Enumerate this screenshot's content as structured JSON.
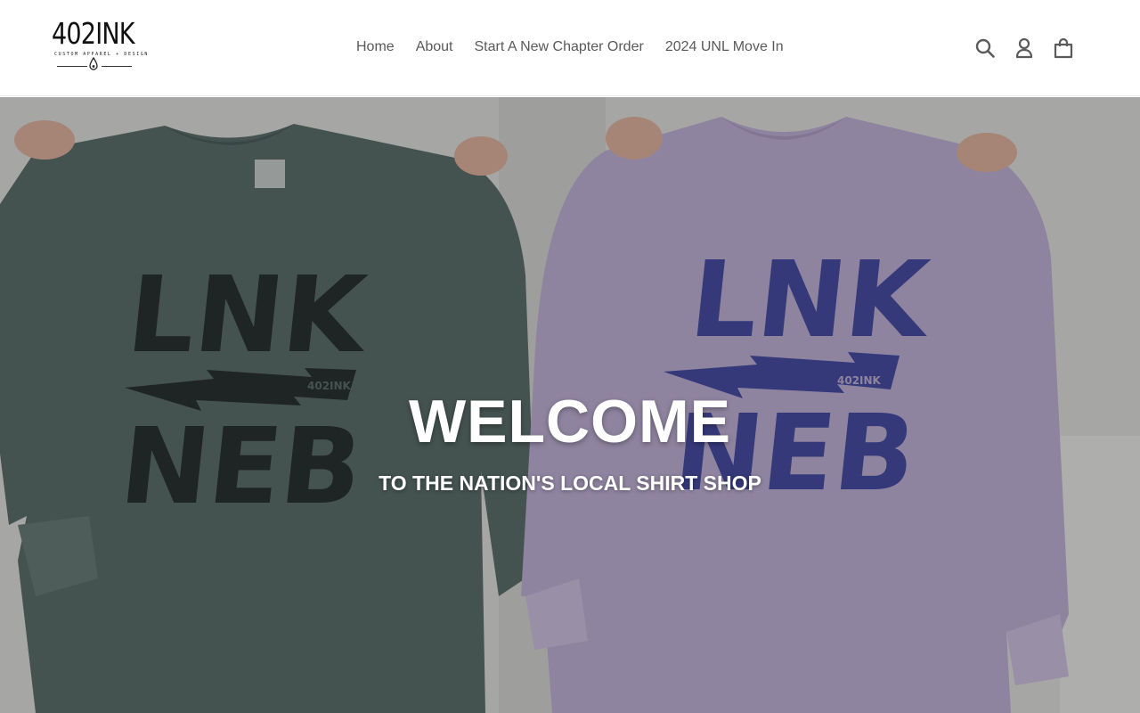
{
  "brand": {
    "logo_text": "402INK",
    "logo_tagline": "CUSTOM APPAREL + DESIGN"
  },
  "nav": {
    "items": [
      {
        "label": "Home"
      },
      {
        "label": "About"
      },
      {
        "label": "Start A New Chapter Order"
      },
      {
        "label": "2024 UNL Move In"
      }
    ]
  },
  "header_icons": {
    "search": "search-icon",
    "account": "account-icon",
    "cart": "cart-icon"
  },
  "hero": {
    "title": "WELCOME",
    "subtitle": "TO THE NATION'S LOCAL SHIRT SHOP",
    "shirt_left": {
      "line1": "LNK",
      "line2": "NEB",
      "tag": "402INK",
      "color": "#5f7370",
      "ink": "#2c3433"
    },
    "shirt_right": {
      "line1": "LNK",
      "line2": "NEB",
      "tag": "402INK",
      "color": "#c6b7de",
      "ink": "#4a50a8"
    }
  },
  "colors": {
    "nav_text": "#5a5a5a",
    "icon": "#5a5a5a",
    "hero_text": "#ffffff"
  }
}
